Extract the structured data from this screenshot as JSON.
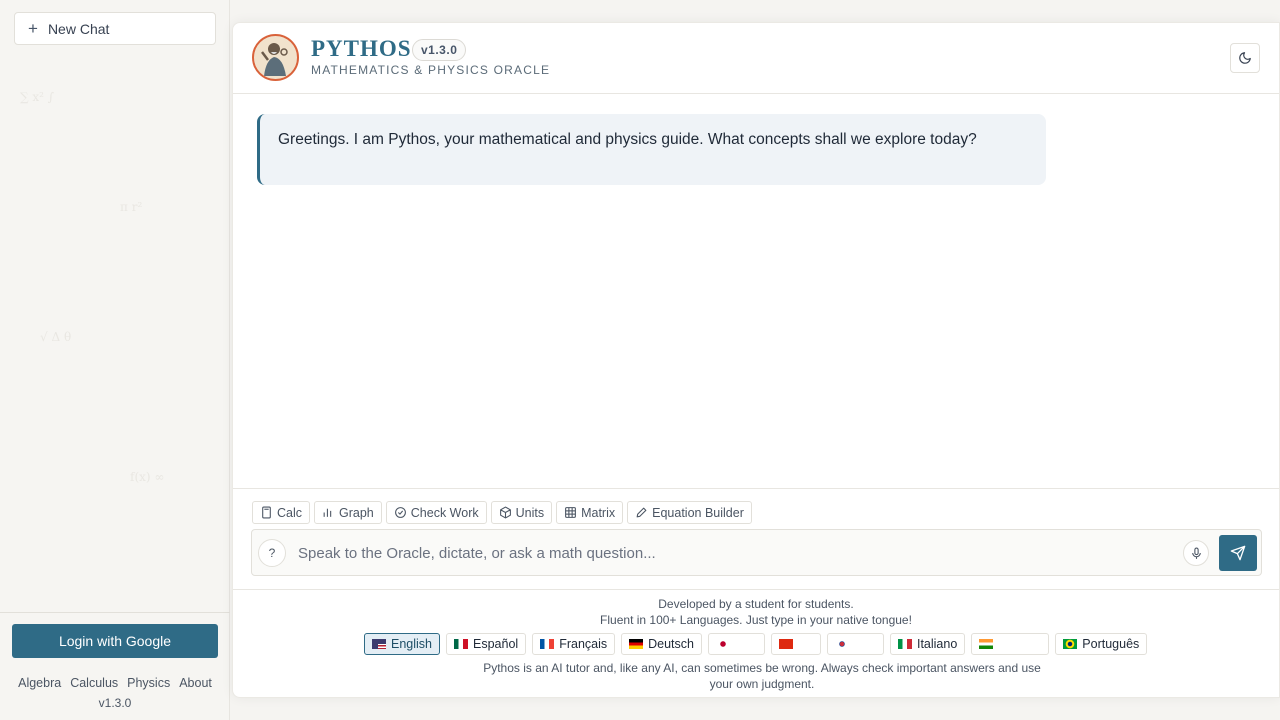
{
  "sidebar": {
    "new_chat_label": "New Chat",
    "login_label": "Login with Google",
    "links": [
      "Algebra",
      "Calculus",
      "Physics",
      "About"
    ],
    "version": "v1.3.0"
  },
  "header": {
    "title": "PYTHOS",
    "version_badge": "v1.3.0",
    "tagline": "MATHEMATICS & PHYSICS ORACLE"
  },
  "messages": [
    {
      "role": "assistant",
      "text": "Greetings. I am Pythos, your mathematical and physics guide. What concepts shall we explore today?"
    }
  ],
  "tools": [
    {
      "label": "Calc",
      "icon": "calculator-icon"
    },
    {
      "label": "Graph",
      "icon": "bar-chart-icon"
    },
    {
      "label": "Check Work",
      "icon": "check-circle-icon"
    },
    {
      "label": "Units",
      "icon": "cube-icon"
    },
    {
      "label": "Matrix",
      "icon": "grid-icon"
    },
    {
      "label": "Equation Builder",
      "icon": "pencil-icon"
    }
  ],
  "composer": {
    "help_label": "?",
    "placeholder": "Speak to the Oracle, dictate, or ask a math question..."
  },
  "footer": {
    "developed_by": "Developed by a student for students.",
    "fluent": "Fluent in 100+ Languages. Just type in your native tongue!",
    "languages": [
      {
        "label": "English",
        "flag": "us",
        "active": true
      },
      {
        "label": "Español",
        "flag": "mx"
      },
      {
        "label": "Français",
        "flag": "fr"
      },
      {
        "label": "Deutsch",
        "flag": "de"
      },
      {
        "label": "",
        "flag": "jp"
      },
      {
        "label": "",
        "flag": "cn"
      },
      {
        "label": "",
        "flag": "kr"
      },
      {
        "label": "Italiano",
        "flag": "it"
      },
      {
        "label": "",
        "flag": "in"
      },
      {
        "label": "Português",
        "flag": "br"
      }
    ],
    "disclaimer": "Pythos is an AI tutor and, like any AI, can sometimes be wrong. Always check important answers and use your own judgment."
  },
  "colors": {
    "accent": "#2f6b86",
    "logo_ring": "#d9623a",
    "bubble_bg": "#eff3f7"
  }
}
